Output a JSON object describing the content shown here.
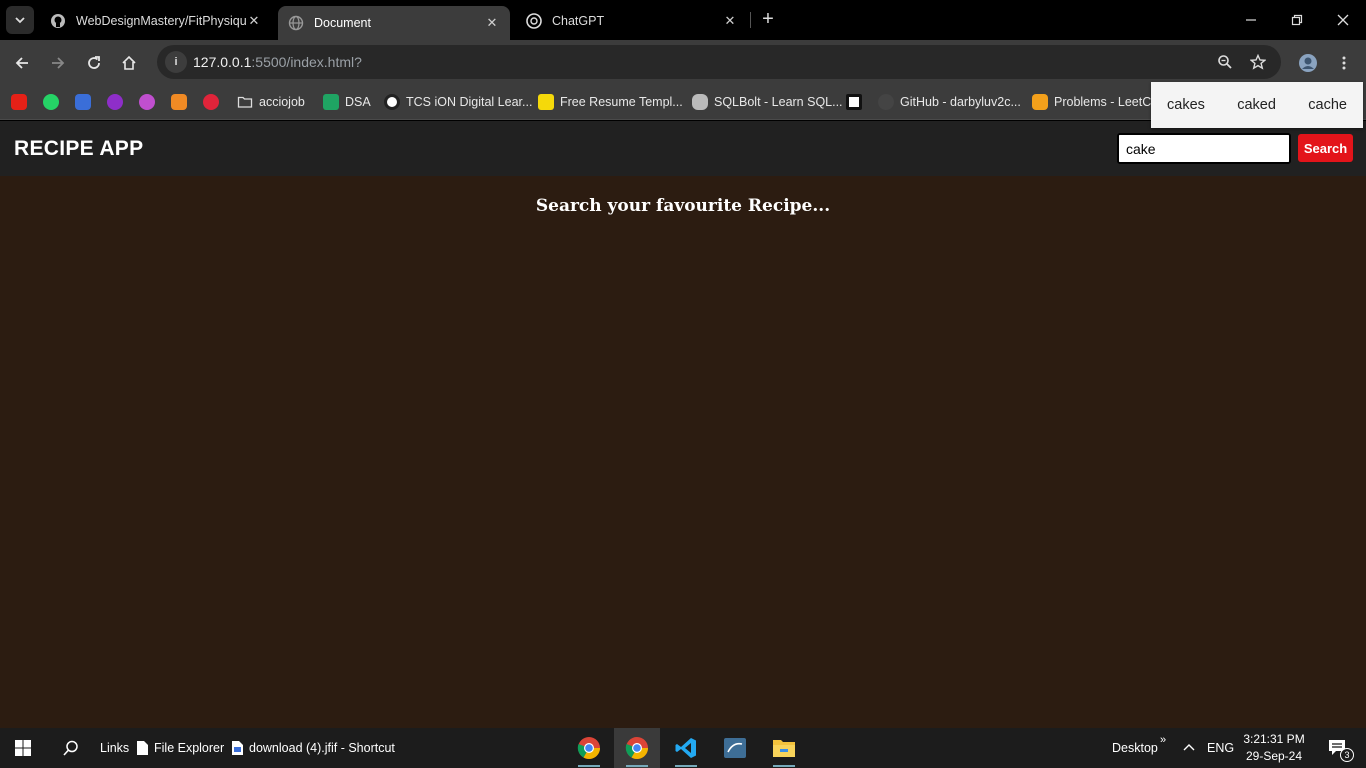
{
  "browser": {
    "tabs": [
      {
        "title": "WebDesignMastery/FitPhysique",
        "icon": "github-icon"
      },
      {
        "title": "Document",
        "icon": "globe-icon"
      },
      {
        "title": "ChatGPT",
        "icon": "chatgpt-icon"
      }
    ],
    "url_host": "127.0.0.1",
    "url_rest": ":5500/index.html?",
    "bookmarks": [
      {
        "label": "acciojob",
        "icon": "folder-icon"
      },
      {
        "label": "DSA",
        "icon": "sheets-icon"
      },
      {
        "label": "TCS iON Digital Lear...",
        "icon": "tcs-icon"
      },
      {
        "label": "Free Resume Templ...",
        "icon": "resume-icon"
      },
      {
        "label": "SQLBolt - Learn SQL...",
        "icon": "database-icon"
      },
      {
        "label": "GitHub - darbyluv2c...",
        "icon": "github-icon"
      },
      {
        "label": "Problems - LeetCo",
        "icon": "leetcode-icon"
      }
    ]
  },
  "app": {
    "title": "RECIPE APP",
    "search_value": "cake",
    "search_button": "Search",
    "heading": "Search your favourite Recipe...",
    "suggestions": [
      "cakes",
      "caked",
      "cache"
    ]
  },
  "taskbar": {
    "links_label": "Links",
    "file_explorer": "File Explorer",
    "shortcut": "download (4).jfif - Shortcut",
    "desktop_label": "Desktop",
    "language": "ENG",
    "time": "3:21:31 PM",
    "date": "29-Sep-24",
    "notifications": "3"
  },
  "colors": {
    "main_bg": "#2c1c11",
    "header_bg": "#212121",
    "search_button_bg": "#e3141a"
  }
}
